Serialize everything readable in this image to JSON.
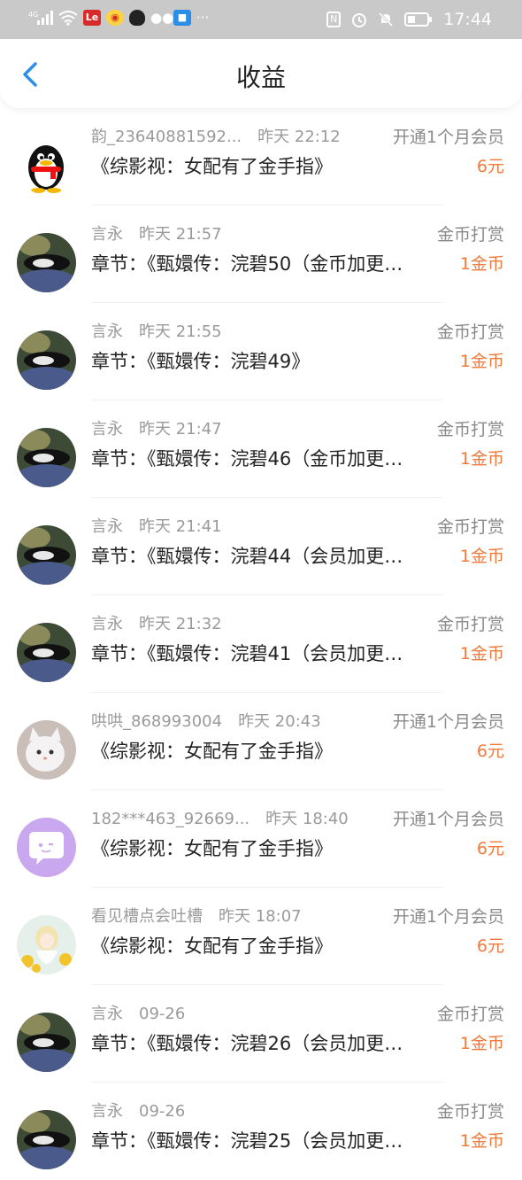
{
  "status_bar": {
    "time": "17:44",
    "left_icons": [
      "signal-4g-icon",
      "wifi-icon",
      "le-app-icon",
      "weibo-icon",
      "qq-icon",
      "wechat-icon",
      "app-icon",
      "more-dots-icon"
    ],
    "right_icons": [
      "nfc-icon",
      "alarm-icon",
      "mute-icon",
      "battery-icon"
    ]
  },
  "header": {
    "title": "收益"
  },
  "records": [
    {
      "user": "韵_23640881592...",
      "time": "昨天 22:12",
      "type": "开通1个月会员",
      "content": "《综影视：女配有了金手指》",
      "amount": "6元",
      "avatar": "qq-penguin"
    },
    {
      "user": "言永",
      "time": "昨天 21:57",
      "type": "金币打赏",
      "content": "章节：《甄嬛传：浣碧50（金币加更…",
      "amount": "1金币",
      "avatar": "cat-photo"
    },
    {
      "user": "言永",
      "time": "昨天 21:55",
      "type": "金币打赏",
      "content": "章节：《甄嬛传：浣碧49》",
      "amount": "1金币",
      "avatar": "cat-photo"
    },
    {
      "user": "言永",
      "time": "昨天 21:47",
      "type": "金币打赏",
      "content": "章节：《甄嬛传：浣碧46（金币加更…",
      "amount": "1金币",
      "avatar": "cat-photo"
    },
    {
      "user": "言永",
      "time": "昨天 21:41",
      "type": "金币打赏",
      "content": "章节：《甄嬛传：浣碧44（会员加更…",
      "amount": "1金币",
      "avatar": "cat-photo"
    },
    {
      "user": "言永",
      "time": "昨天 21:32",
      "type": "金币打赏",
      "content": "章节：《甄嬛传：浣碧41（会员加更…",
      "amount": "1金币",
      "avatar": "cat-photo"
    },
    {
      "user": "哄哄_868993004",
      "time": "昨天 20:43",
      "type": "开通1个月会员",
      "content": "《综影视：女配有了金手指》",
      "amount": "6元",
      "avatar": "white-cat"
    },
    {
      "user": "182***463_92669...",
      "time": "昨天 18:40",
      "type": "开通1个月会员",
      "content": "《综影视：女配有了金手指》",
      "amount": "6元",
      "avatar": "purple-chat"
    },
    {
      "user": "看见槽点会吐槽",
      "time": "昨天 18:07",
      "type": "开通1个月会员",
      "content": "《综影视：女配有了金手指》",
      "amount": "6元",
      "avatar": "anime-girl"
    },
    {
      "user": "言永",
      "time": "09-26",
      "type": "金币打赏",
      "content": "章节：《甄嬛传：浣碧26（会员加更…",
      "amount": "1金币",
      "avatar": "cat-photo"
    },
    {
      "user": "言永",
      "time": "09-26",
      "type": "金币打赏",
      "content": "章节：《甄嬛传：浣碧25（会员加更…",
      "amount": "1金币",
      "avatar": "cat-photo"
    }
  ],
  "colors": {
    "accent": "#2f8ee6",
    "amount": "#f07a3c",
    "statusbar": "#c9c9c9"
  }
}
